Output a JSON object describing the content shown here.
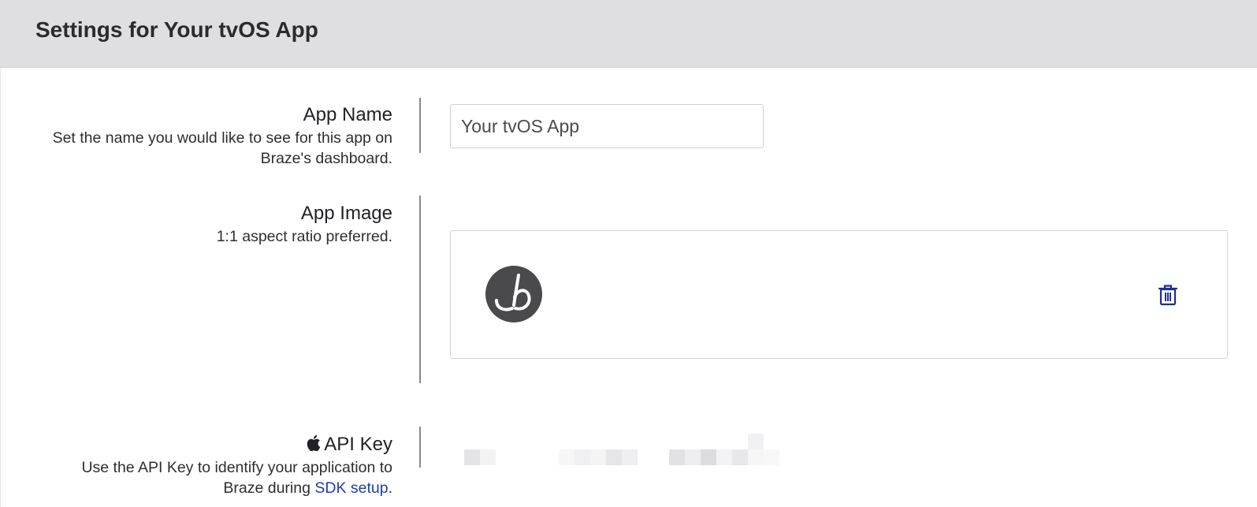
{
  "header": {
    "title": "Settings for Your tvOS App"
  },
  "app_name": {
    "title": "App Name",
    "description_line1": "Set the name you would like to see for this app on",
    "description_line2": "Braze's dashboard.",
    "input_value": "Your tvOS App"
  },
  "app_image": {
    "title": "App Image",
    "description": "1:1 aspect ratio preferred.",
    "logo_icon": "braze-logo",
    "delete_icon": "trash-icon"
  },
  "api_key": {
    "icon": "apple-icon",
    "title": "API Key",
    "description_line1": "Use the API Key to identify your application to",
    "description_prefix": "Braze during ",
    "link_text": "SDK setup",
    "description_suffix": "."
  },
  "colors": {
    "header_bg": "#dfdfe3",
    "link": "#1f3fa8",
    "trash_icon": "#1f2f8f",
    "logo_bg": "#4a4a4d"
  }
}
